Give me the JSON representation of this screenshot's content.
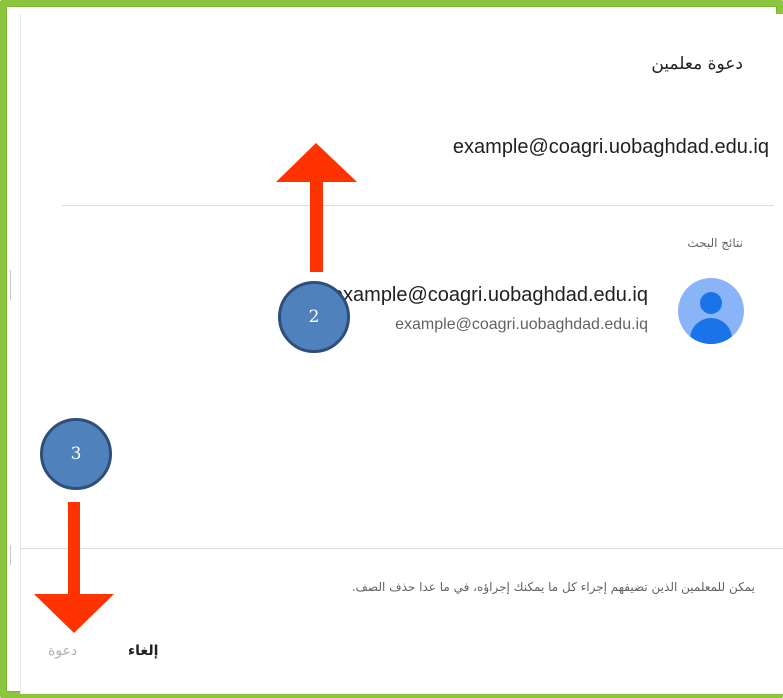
{
  "dialog": {
    "title": "دعوة معلمين",
    "email_input_value": "example@coagri.uobaghdad.edu.iq",
    "search_results_label": "نتائج البحث",
    "result": {
      "name": "example@coagri.uobaghdad.edu.iq",
      "email": "example@coagri.uobaghdad.edu.iq",
      "avatar_icon": "person-icon"
    },
    "footer_note": "يمكن للمعلمين الذين تضيفهم إجراء كل ما يمكنك إجراؤه، في ما عدا حذف الصف.",
    "cancel_label": "إلغاء",
    "invite_label": "دعوة"
  },
  "annotations": {
    "step_2": "2",
    "step_3": "3",
    "arrow_color": "#ff3300",
    "badge_color": "#4f81bd"
  },
  "colors": {
    "frame_border": "#8cc63f",
    "avatar_bg": "#8ab4f8",
    "avatar_fg": "#1a73e8"
  }
}
